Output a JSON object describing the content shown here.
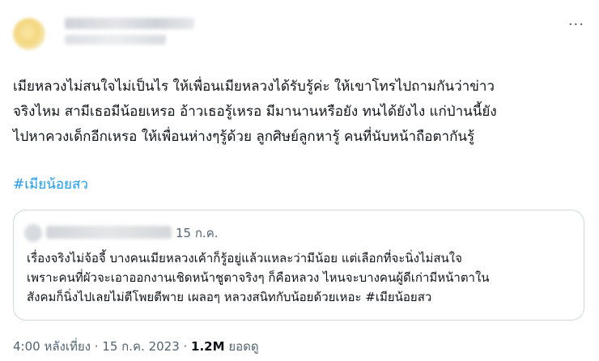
{
  "header": {
    "more_label": "···"
  },
  "tweet": {
    "lines": [
      "เมียหลวงไม่สนใจไม่เป็นไร ให้เพื่อนเมียหลวงได้รับรู้ค่ะ ให้เขาโทรไปถามกันว่าข่าว",
      "จริงไหม สามีเธอมีน้อยเหรอ อ้าวเธอรู้เหรอ มีมานานหรือยัง ทนได้ยังไง แก่ป่านนี้ยัง",
      "ไปหาควงเด็กอีกเหรอ ให้เพื่อนห่างๆรู้ด้วย ลูกศิษย์ลูกหารู้ คนที่นับหน้าถือตากันรู้"
    ],
    "hashtag": "#เมียน้อยสว"
  },
  "quote": {
    "date": "15 ก.ค.",
    "lines": [
      "เรื่องจริงไม่จ้อจี้ บางคนเมียหลวงเค้าก็รู้อยู่แล้วแหละว่ามีน้อย แต่เลือกที่จะนิ่งไม่สนใจ",
      "เพราะคนที่ผัวจะเอาออกงานเชิดหน้าชูตาจริงๆ ก็คือหลวง ไหนจะบางคนผู้ดีเก่ามีหน้าตาใน",
      "สังคมก็นิ่งไปเลยไม่ตีโพยตีพาย เผลอๆ หลวงสนิทกับน้อยด้วยเหอะ #เมียน้อยสว"
    ]
  },
  "meta": {
    "time_date": "4:00 หลังเที่ยง · 15 ก.ค. 2023 · ",
    "views": "1.2M",
    "views_label": " ยอดดู"
  },
  "colors": {
    "text": "#0f1419",
    "secondary": "#536471",
    "link": "#1d9bf0",
    "border": "#cfd9de"
  }
}
